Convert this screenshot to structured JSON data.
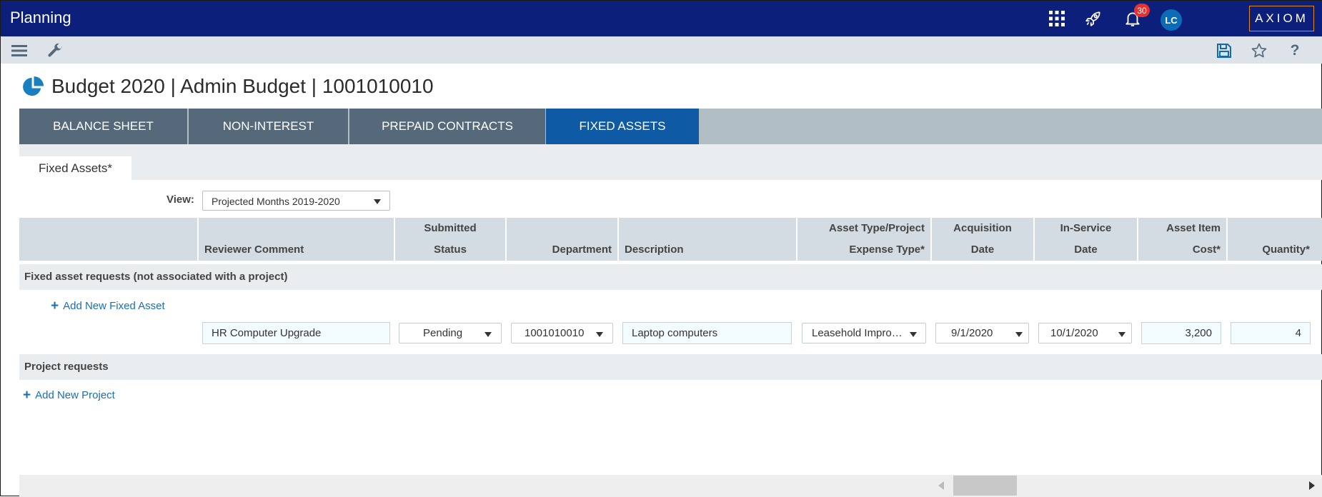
{
  "app": {
    "title": "Planning",
    "brand": "AXIOM",
    "notification_count": "30",
    "user_initials": "LC"
  },
  "toolbar": {
    "left_icons": [
      "menu-icon",
      "wrench-icon"
    ],
    "right_icons": [
      "save-icon",
      "star-icon",
      "help-icon"
    ],
    "help_glyph": "?"
  },
  "page": {
    "title": "Budget 2020 | Admin Budget | 1001010010"
  },
  "tabs": [
    {
      "label": "BALANCE SHEET",
      "active": false
    },
    {
      "label": "NON-INTEREST",
      "active": false
    },
    {
      "label": "PREPAID CONTRACTS",
      "active": false
    },
    {
      "label": "FIXED ASSETS",
      "active": true
    }
  ],
  "subtab": {
    "label": "Fixed Assets*"
  },
  "view": {
    "label": "View:",
    "selected": "Projected Months 2019-2020"
  },
  "columns": [
    {
      "line1": "",
      "line2": ""
    },
    {
      "line1": "",
      "line2": "Reviewer Comment"
    },
    {
      "line1": "Submitted",
      "line2": "Status"
    },
    {
      "line1": "",
      "line2": "Department"
    },
    {
      "line1": "",
      "line2": "Description"
    },
    {
      "line1": "Asset Type/Project",
      "line2": "Expense Type*"
    },
    {
      "line1": "Acquisition",
      "line2": "Date"
    },
    {
      "line1": "In-Service",
      "line2": "Date"
    },
    {
      "line1": "Asset Item",
      "line2": "Cost*"
    },
    {
      "line1": "",
      "line2": "Quantity*"
    }
  ],
  "sections": {
    "fixed": {
      "title": "Fixed asset requests (not associated with a project)",
      "add_label": "Add New Fixed Asset"
    },
    "project": {
      "title": "Project requests",
      "add_label": "Add New Project"
    }
  },
  "row": {
    "reviewer_comment": "HR Computer Upgrade",
    "status": "Pending",
    "department": "1001010010",
    "description": "Laptop computers",
    "asset_type": "Leasehold Impro…",
    "acquisition_date": "9/1/2020",
    "in_service_date": "10/1/2020",
    "cost": "3,200",
    "quantity": "4"
  },
  "colors": {
    "header": "#0c1f7a",
    "tab": "#55697a",
    "tab_active": "#0f5aa5",
    "link": "#1a6fb6",
    "brand_border": "#e38a1b",
    "badge": "#e8312f"
  }
}
